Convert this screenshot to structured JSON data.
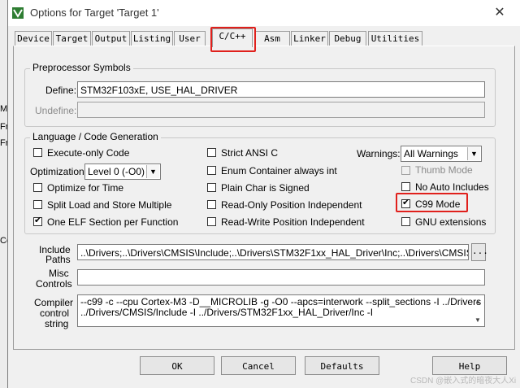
{
  "window": {
    "title": "Options for Target 'Target 1'",
    "close_glyph": "✕"
  },
  "background_chars": [
    "M",
    "Fr",
    "Fr",
    "Co",
    "_",
    "_",
    "_"
  ],
  "tabs": [
    {
      "label": "Device",
      "active": false
    },
    {
      "label": "Target",
      "active": false
    },
    {
      "label": "Output",
      "active": false
    },
    {
      "label": "Listing",
      "active": false
    },
    {
      "label": "User",
      "active": false
    },
    {
      "label": "C/C++",
      "active": true
    },
    {
      "label": "Asm",
      "active": false
    },
    {
      "label": "Linker",
      "active": false
    },
    {
      "label": "Debug",
      "active": false
    },
    {
      "label": "Utilities",
      "active": false
    }
  ],
  "preprocessor": {
    "legend": "Preprocessor Symbols",
    "define_label": "Define:",
    "define_value": "STM32F103xE, USE_HAL_DRIVER",
    "undefine_label": "Undefine:",
    "undefine_value": ""
  },
  "language": {
    "legend": "Language / Code Generation",
    "execute_only": {
      "label": "Execute-only Code",
      "checked": false
    },
    "optimization_label": "Optimization:",
    "optimization_value": "Level 0 (-O0)",
    "optimize_time": {
      "label": "Optimize for Time",
      "checked": false
    },
    "split_load": {
      "label": "Split Load and Store Multiple",
      "checked": false
    },
    "one_elf": {
      "label": "One ELF Section per Function",
      "checked": true
    },
    "strict_ansi": {
      "label": "Strict ANSI C",
      "checked": false
    },
    "enum_container": {
      "label": "Enum Container always int",
      "checked": false
    },
    "plain_char": {
      "label": "Plain Char is Signed",
      "checked": false
    },
    "ro_pi": {
      "label": "Read-Only Position Independent",
      "checked": false
    },
    "rw_pi": {
      "label": "Read-Write Position Independent",
      "checked": false
    },
    "warnings_label": "Warnings:",
    "warnings_value": "All Warnings",
    "thumb_mode": {
      "label": "Thumb Mode",
      "checked": false,
      "disabled": true
    },
    "no_auto_includes": {
      "label": "No Auto Includes",
      "checked": false
    },
    "c99_mode": {
      "label": "C99 Mode",
      "checked": true
    },
    "gnu_extensions": {
      "label": "GNU extensions",
      "checked": false
    }
  },
  "include_paths": {
    "label_line1": "Include",
    "label_line2": "Paths",
    "value": "..\\Drivers;..\\Drivers\\CMSIS\\Include;..\\Drivers\\STM32F1xx_HAL_Driver\\Inc;..\\Drivers\\CMSIS\\Devic",
    "browse_label": "..."
  },
  "misc_controls": {
    "label_line1": "Misc",
    "label_line2": "Controls",
    "value": ""
  },
  "compiler_control": {
    "label_line1": "Compiler",
    "label_line2": "control",
    "label_line3": "string",
    "line1": "--c99 -c --cpu Cortex-M3 -D__MICROLIB -g -O0 --apcs=interwork --split_sections -I ../Drivers -I",
    "line2": "../Drivers/CMSIS/Include -I ../Drivers/STM32F1xx_HAL_Driver/Inc -I"
  },
  "buttons": {
    "ok": "OK",
    "cancel": "Cancel",
    "defaults": "Defaults",
    "help": "Help"
  },
  "watermark": "CSDN @嵌入式的暗夜大人Xi",
  "colors": {
    "highlight": "#e0201c",
    "dialog_bg": "#f0f0f0"
  },
  "icons": {
    "logo": "keil-logo-icon",
    "close": "close-icon"
  }
}
